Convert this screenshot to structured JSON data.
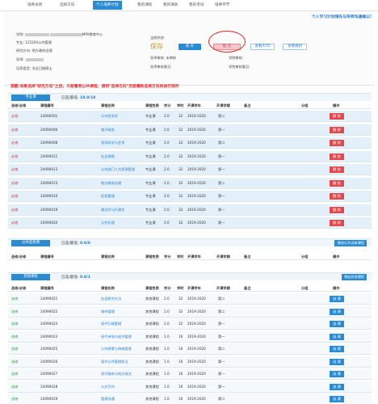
{
  "tabs": [
    "培养总则",
    "选择方向",
    "个人培养计划",
    "我的课程",
    "我的课表",
    "我的考试",
    "培养环节"
  ],
  "info": {
    "notice": "个人学习计划请先与导师沟通确认!",
    "student_label": "学院:",
    "student_tail": "MPA教育中心",
    "major_label": "专业:",
    "major_value": "125200公共管理",
    "direction_label": "研究方向:",
    "direction_value": "地方政府治理",
    "tutor_label": "导师:",
    "tutor_value": "",
    "type_label": "培养类型:",
    "type_value": "非全日制硕士",
    "status_label": "当前状态:",
    "save_status": "保存",
    "save_button": "保 存",
    "submit_button": "提 交",
    "view_print_button": "查看/打印",
    "view_rules_button": "查看规则",
    "tutor_review_label": "导师审核:",
    "tutor_review_value": "未审核",
    "tutor_opinion_label": "导师审核意见:",
    "school_review_label": "学院审核:",
    "school_opinion_label": "学院审核意见:"
  },
  "tip": "提醒:如果选择\"研究方向\"之后，只能看到公共课程，请到\"选择方向\"页面重新选择方向再进行保存",
  "columns": [
    "选修/必修",
    "课程编号",
    "课程名称",
    "课程性质",
    "学分",
    "学时",
    "开课学年",
    "开课学期",
    "备注",
    "分组",
    "操作"
  ],
  "sections": {
    "professional": {
      "label": "专业课",
      "credit_label": "已选/最低:",
      "credit_value": "18.0/18"
    },
    "public_elective": {
      "label": "公共选修课",
      "credit_label": "已选/最低:",
      "credit_value": "0.0/0",
      "right_button": "增加公共选修课程"
    },
    "other": {
      "label": "其他课程",
      "credit_label": "已选/最低:",
      "credit_value": "0.0/1",
      "right_button": "增加其他课程"
    }
  },
  "professional_rows": [
    {
      "type": "必修",
      "code": "24090001",
      "name": "公共经济学",
      "nature": "专业课",
      "credit": "2.0",
      "hours": "32",
      "year": "2019-2020",
      "term": "第二",
      "action": "删 除"
    },
    {
      "type": "必修",
      "code": "24090006",
      "name": "电子政务",
      "nature": "专业课",
      "credit": "2.0",
      "hours": "32",
      "year": "2019-2020",
      "term": "第一",
      "action": "删 除"
    },
    {
      "type": "必修",
      "code": "24090008",
      "name": "领导科学与艺术",
      "nature": "专业课",
      "credit": "2.0",
      "hours": "32",
      "year": "2019-2020",
      "term": "第二",
      "action": "删 除"
    },
    {
      "type": "必修",
      "code": "24090011",
      "name": "社会保障",
      "nature": "专业课",
      "credit": "2.0",
      "hours": "32",
      "year": "2019-2020",
      "term": "第一",
      "action": "删 除"
    },
    {
      "type": "必修",
      "code": "24090013",
      "name": "公共部门人力资源管理",
      "nature": "专业课",
      "credit": "2.0",
      "hours": "32",
      "year": "2019-2020",
      "term": "第一",
      "action": "删 除"
    },
    {
      "type": "必修",
      "code": "24090015",
      "name": "地方政府治理",
      "nature": "专业课",
      "credit": "2.0",
      "hours": "32",
      "year": "2019-2020",
      "term": "第二",
      "action": "删 除"
    },
    {
      "type": "必修",
      "code": "24090016",
      "name": "危机管理",
      "nature": "专业课",
      "credit": "2.0",
      "hours": "32",
      "year": "2019-2020",
      "term": "第一",
      "action": "删 除"
    },
    {
      "type": "必修",
      "code": "24090019",
      "name": "政治学与行政学",
      "nature": "专业课",
      "credit": "2.0",
      "hours": "32",
      "year": "2019-2020",
      "term": "第一",
      "action": "删 除"
    },
    {
      "type": "必修",
      "code": "24090020",
      "name": "公共伦理",
      "nature": "专业课",
      "credit": "2.0",
      "hours": "32",
      "year": "2019-2020",
      "term": "第一",
      "action": "删 除"
    }
  ],
  "other_rows": [
    {
      "type": "选修",
      "code": "24090021",
      "name": "社会研究方法",
      "nature": "其他课程",
      "credit": "2.0",
      "hours": "32",
      "year": "2019-2020",
      "term": "第二",
      "action": "选 课"
    },
    {
      "type": "选修",
      "code": "24090022",
      "name": "城市管理",
      "nature": "其他课程",
      "credit": "2.0",
      "hours": "32",
      "year": "2019-2020",
      "term": "第二",
      "action": "选 课"
    },
    {
      "type": "选修",
      "code": "24090023",
      "name": "现代行政管理",
      "nature": "其他课程",
      "credit": "2.0",
      "hours": "32",
      "year": "2019-2020",
      "term": "第一",
      "action": "选 课"
    },
    {
      "type": "选修",
      "code": "24090024",
      "name": "现代市场与经济管理",
      "nature": "其他课程",
      "credit": "1.0",
      "hours": "16",
      "year": "2019-2020",
      "term": "第一",
      "action": "选 课"
    },
    {
      "type": "选修",
      "code": "24090025",
      "name": "公共政策与网络管理",
      "nature": "其他课程",
      "credit": "1.0",
      "hours": "16",
      "year": "2019-2020",
      "term": "第二",
      "action": "选 课"
    },
    {
      "type": "选修",
      "code": "24090026",
      "name": "现代公共管理前沿",
      "nature": "其他课程",
      "credit": "1.0",
      "hours": "16",
      "year": "2019-2020",
      "term": "第一",
      "action": "选 课"
    },
    {
      "type": "选修",
      "code": "24090027",
      "name": "现代政府与地方政治",
      "nature": "其他课程",
      "credit": "1.0",
      "hours": "16",
      "year": "2019-2020",
      "term": "第一",
      "action": "选 课"
    },
    {
      "type": "选修",
      "code": "24090028",
      "name": "公文写作",
      "nature": "其他课程",
      "credit": "1.0",
      "hours": "16",
      "year": "2019-2020",
      "term": "第一",
      "action": "选 课"
    },
    {
      "type": "选修",
      "code": "24090029",
      "name": "管理沟通",
      "nature": "其他课程",
      "credit": "1.0",
      "hours": "16",
      "year": "2019-2020",
      "term": "第二",
      "action": "选 课"
    }
  ]
}
